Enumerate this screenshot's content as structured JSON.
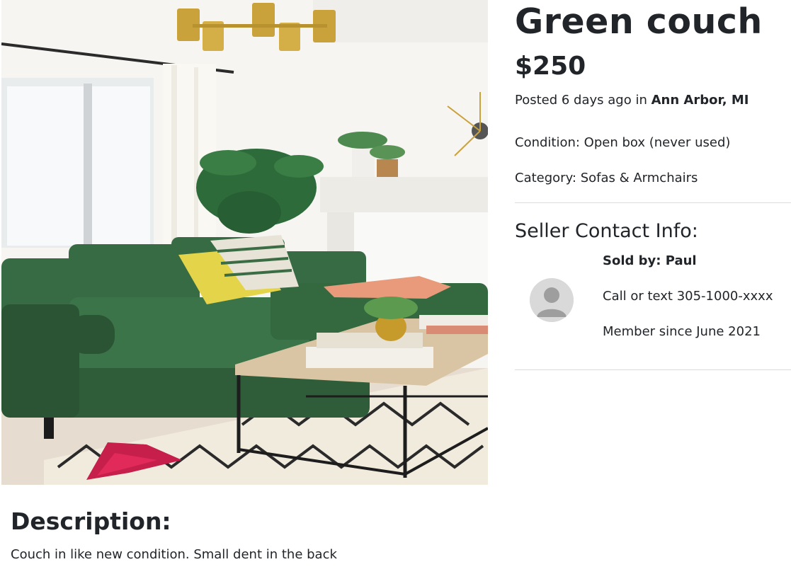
{
  "listing": {
    "title": "Green couch",
    "price": "$250",
    "posted_prefix": "Posted 6 days ago in ",
    "location": "Ann Arbor, MI",
    "condition": "Condition: Open box (never used)",
    "category": "Category: Sofas & Armchairs",
    "photo_icon": "living-room-photo"
  },
  "seller": {
    "heading": "Seller Contact Info:",
    "sold_by": "Sold by: Paul",
    "phone": "Call or text 305-1000-xxxx",
    "member_since": "Member since June 2021",
    "avatar_icon": "default-user-avatar"
  },
  "description": {
    "heading": "Description:",
    "text": "Couch in like new condition. Small dent in the back"
  },
  "colors": {
    "text": "#212529",
    "sofa_green": "#2f5d3a",
    "divider": "#dcdcdc",
    "avatar_bg": "#d9d9d9"
  }
}
